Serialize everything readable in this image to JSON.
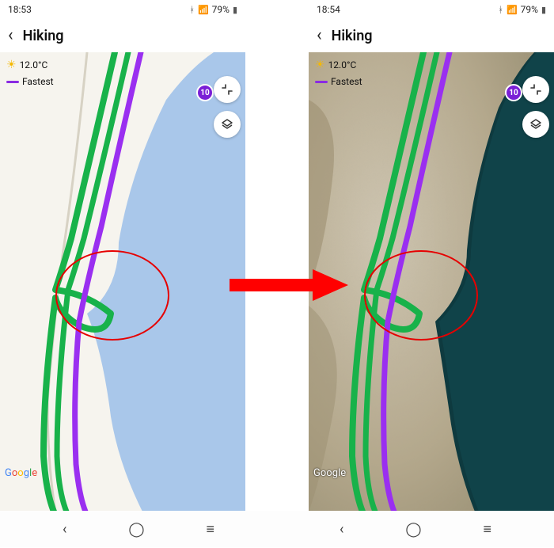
{
  "left": {
    "status": {
      "time": "18:53",
      "battery": "79%"
    },
    "header": {
      "title": "Hiking"
    },
    "overlay": {
      "temperature": "12.0°C",
      "legend_label": "Fastest",
      "legend_color": "#8a2be2",
      "route_badge": "10"
    },
    "attribution": "Google"
  },
  "right": {
    "status": {
      "time": "18:54",
      "battery": "79%"
    },
    "header": {
      "title": "Hiking"
    },
    "overlay": {
      "temperature": "12.0°C",
      "legend_label": "Fastest",
      "legend_color": "#8a2be2",
      "route_badge": "10"
    },
    "attribution": "Google"
  },
  "annotation": {
    "highlight_shape": "ellipse",
    "arrow_direction": "left-to-right",
    "meaning": "map layer switched from default to satellite"
  }
}
